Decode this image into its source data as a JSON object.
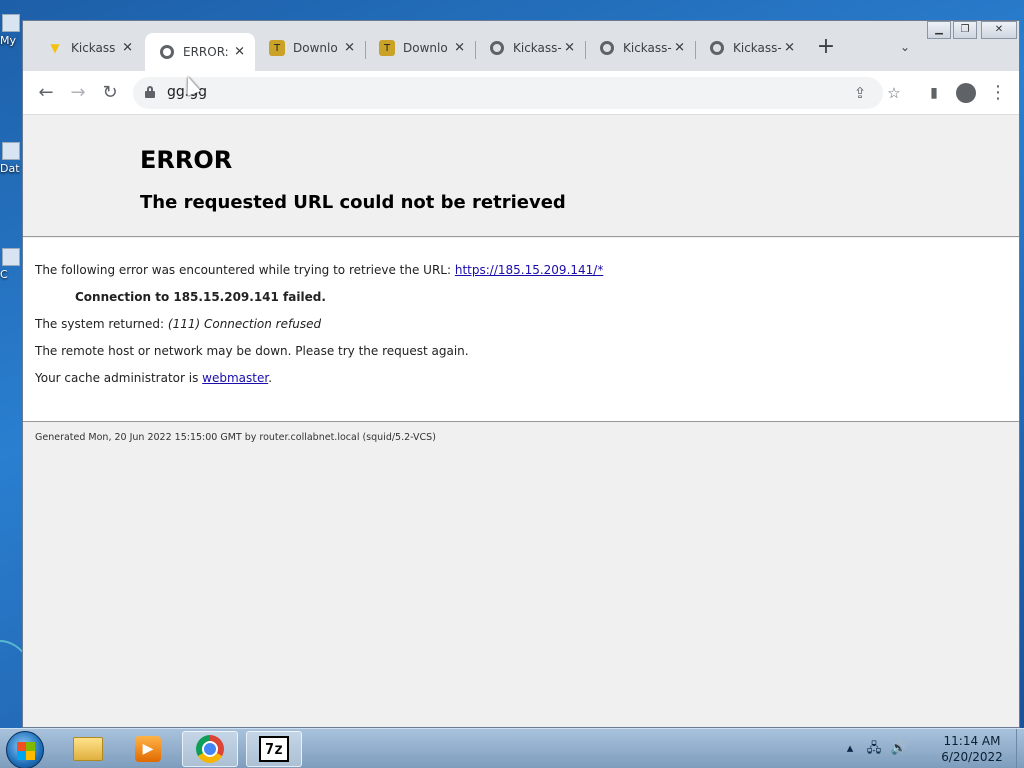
{
  "desktop": {
    "fragments": [
      "My",
      "Dat",
      "C"
    ]
  },
  "tabs": [
    {
      "title": "Kickass",
      "icon": "kickass-icon",
      "active": false
    },
    {
      "title": "ERROR:",
      "icon": "globe-icon",
      "active": true
    },
    {
      "title": "Downlo",
      "icon": "torrent-icon",
      "active": false
    },
    {
      "title": "Downlo",
      "icon": "torrent-icon",
      "active": false
    },
    {
      "title": "Kickass-",
      "icon": "globe-icon",
      "active": false
    },
    {
      "title": "Kickass-",
      "icon": "globe-icon",
      "active": false
    },
    {
      "title": "Kickass-",
      "icon": "globe-icon",
      "active": false
    }
  ],
  "toolbar": {
    "url": "gg.gg"
  },
  "error_page": {
    "title": "ERROR",
    "subtitle": "The requested URL could not be retrieved",
    "line1_prefix": "The following error was encountered while trying to retrieve the URL: ",
    "line1_link": "https://185.15.209.141/*",
    "line2": "Connection to 185.15.209.141 failed.",
    "line3_prefix": "The system returned: ",
    "line3_error": "(111) Connection refused",
    "line4": "The remote host or network may be down. Please try the request again.",
    "line5_prefix": "Your cache administrator is ",
    "line5_link": "webmaster",
    "line5_suffix": ".",
    "footer": "Generated Mon, 20 Jun 2022 15:15:00 GMT by router.collabnet.local (squid/5.2-VCS)"
  },
  "taskbar": {
    "clock_time": "11:14 AM",
    "clock_date": "6/20/2022"
  }
}
